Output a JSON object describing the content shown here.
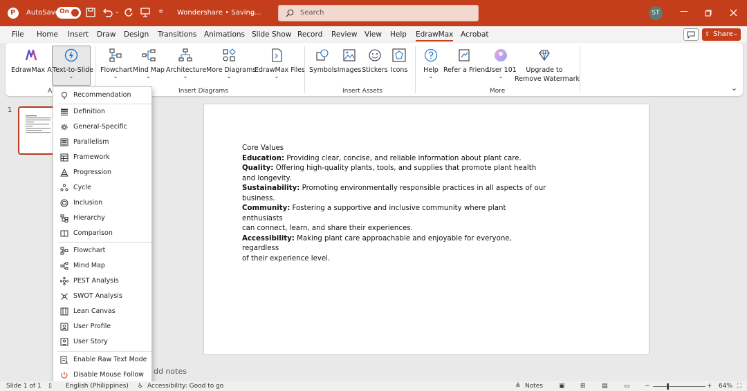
{
  "titlebar": {
    "autosave_label": "AutoSave",
    "autosave_state": "On",
    "doc_title": "Wondershare • Saving...",
    "search_placeholder": "Search",
    "user_initials": "ST"
  },
  "menu": {
    "items": [
      "File",
      "Home",
      "Insert",
      "Draw",
      "Design",
      "Transitions",
      "Animations",
      "Slide Show",
      "Record",
      "Review",
      "View",
      "Help",
      "EdrawMax",
      "Acrobat"
    ],
    "active": "EdrawMax",
    "share_label": "Share"
  },
  "ribbon": {
    "buttons": {
      "edrawmax_ai": "EdrawMax AI",
      "text_to_slide": "Text-to-Slide",
      "flowchart": "Flowchart",
      "mind_map": "Mind Map",
      "architecture": "Architecture",
      "more_diagrams": "More Diagrams",
      "edrawmax_files": "EdrawMax Files",
      "symbols": "Symbols",
      "images": "Images",
      "stickers": "Stickers",
      "icons": "Icons",
      "help": "Help",
      "refer_friend": "Refer a Friend",
      "user101": "User 101",
      "upgrade_line1": "Upgrade to",
      "upgrade_line2": "Remove Watermark"
    },
    "groups": {
      "ai_partial": "A",
      "insert_diagrams": "Insert Diagrams",
      "insert_assets": "Insert Assets",
      "more": "More"
    }
  },
  "dropdown": {
    "items": [
      "Recommendation",
      "Definition",
      "General-Specific",
      "Parallelism",
      "Framework",
      "Progression",
      "Cycle",
      "Inclusion",
      "Hierarchy",
      "Comparison",
      "Flowchart",
      "Mind Map",
      "PEST Analysis",
      "SWOT Analysis",
      "Lean Canvas",
      "User Profile",
      "User Story",
      "Enable Raw Text Mode",
      "Disable Mouse Follow"
    ]
  },
  "slides": {
    "thumb_number": "1",
    "notes_hint": "dd notes"
  },
  "slide": {
    "heading": "Core Values",
    "lines": [
      {
        "bold": "Education:",
        "text": " Providing clear, concise, and reliable information about plant care."
      },
      {
        "bold": "Quality:",
        "text": " Offering high-quality plants, tools, and supplies that promote plant health"
      },
      {
        "bold": "",
        "text": "and longevity."
      },
      {
        "bold": "Sustainability:",
        "text": " Promoting environmentally responsible practices in all aspects of our"
      },
      {
        "bold": "",
        "text": "business."
      },
      {
        "bold": "Community:",
        "text": " Fostering a supportive and inclusive community where plant enthusiasts"
      },
      {
        "bold": "",
        "text": "can connect, learn, and share their experiences."
      },
      {
        "bold": "Accessibility:",
        "text": " Making plant care approachable and enjoyable for everyone, regardless"
      },
      {
        "bold": "",
        "text": "of their experience level."
      }
    ]
  },
  "statusbar": {
    "slide_count": "Slide 1 of 1",
    "language": "English (Philippines)",
    "accessibility": "Accessibility: Good to go",
    "notes": "Notes",
    "zoom": "64%"
  },
  "colors": {
    "brand": "#c43e1c",
    "ribbon_bg": "#ffffff",
    "app_bg": "#e9e9e9"
  }
}
